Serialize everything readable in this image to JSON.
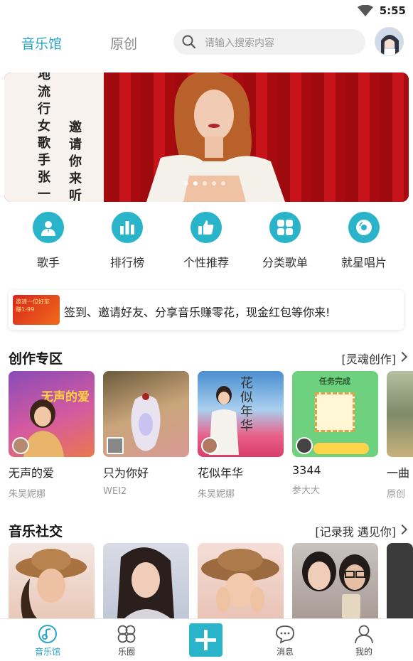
{
  "status_bar": {
    "time": "5:55"
  },
  "header": {
    "tab_active": "音乐馆",
    "tab_inactive": "原创",
    "search_placeholder": "请输入搜索内容"
  },
  "banner": {
    "text_col1": "地流行女歌手张一",
    "text_col2": "邀请你来听音",
    "dots": 5,
    "active_dot": 1
  },
  "quick_actions": [
    {
      "label": "歌手",
      "icon": "singer-icon"
    },
    {
      "label": "排行榜",
      "icon": "chart-icon"
    },
    {
      "label": "个性推荐",
      "icon": "thumbs-up-icon"
    },
    {
      "label": "分类歌单",
      "icon": "grid-icon"
    },
    {
      "label": "就星唱片",
      "icon": "disc-icon"
    }
  ],
  "promo": {
    "thumb_text": "邀请一位好友 赚1-99",
    "text": "签到、邀请好友、分享音乐赚零花，现金红包等你来!"
  },
  "section_create": {
    "title": "创作专区",
    "more": "[灵魂创作]",
    "cards": [
      {
        "name": "无声的爱",
        "artist": "朱吴妮娜",
        "cover_text": "无声的爱"
      },
      {
        "name": "只为你好",
        "artist": "WEI2",
        "cover_text": ""
      },
      {
        "name": "花似年华",
        "artist": "朱吴妮娜",
        "cover_text": "花似年华"
      },
      {
        "name": "3344",
        "artist": "参大大",
        "cover_text": "任务完成"
      },
      {
        "name": "一曲",
        "artist": "原创",
        "cover_text": ""
      }
    ]
  },
  "section_social": {
    "title": "音乐社交",
    "more": "[记录我 遇见你]"
  },
  "bottom_nav": [
    {
      "label": "音乐馆",
      "icon": "music-hall-icon"
    },
    {
      "label": "乐圈",
      "icon": "circle-icon"
    },
    {
      "label": "",
      "icon": "plus-icon"
    },
    {
      "label": "消息",
      "icon": "message-icon"
    },
    {
      "label": "我的",
      "icon": "profile-icon"
    }
  ],
  "colors": {
    "accent": "#2ab4c9",
    "active_text": "#2aa6c8"
  }
}
